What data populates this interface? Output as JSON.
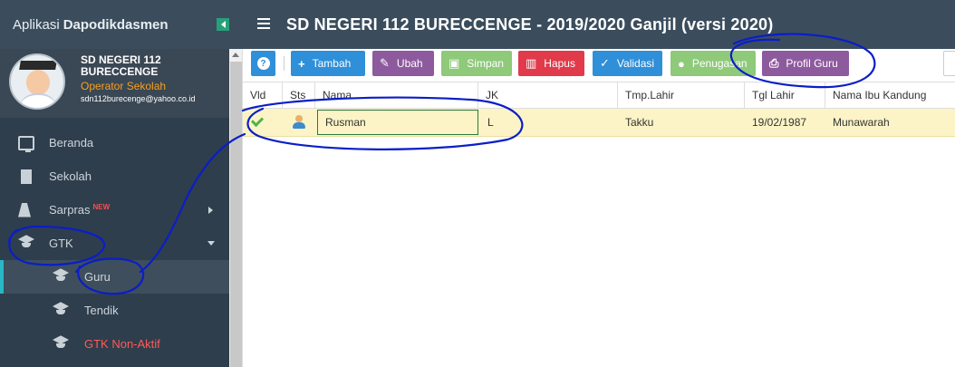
{
  "sidebar": {
    "app_prefix": "Aplikasi",
    "app_name": "Dapodikdasmen",
    "school_name": "SD NEGERI 112 BURECCENGE",
    "role": "Operator Sekolah",
    "email": "sdn112burecenge@yahoo.co.id",
    "items": [
      {
        "label": "Beranda",
        "icon": "monitor-icon"
      },
      {
        "label": "Sekolah",
        "icon": "building-icon"
      },
      {
        "label": "Sarpras",
        "badge": "NEW",
        "icon": "road-icon"
      },
      {
        "label": "GTK",
        "icon": "graduation-cap-icon"
      },
      {
        "label": "Guru",
        "icon": "graduation-cap-icon",
        "active": true
      },
      {
        "label": "Tendik",
        "icon": "graduation-cap-icon"
      },
      {
        "label": "GTK Non-Aktif",
        "icon": "graduation-cap-icon",
        "color": "#ff5a5a"
      }
    ]
  },
  "header": {
    "title": "SD NEGERI 112 BURECCENGE - 2019/2020 Ganjil (versi 2020)"
  },
  "toolbar": {
    "help": "?",
    "add": "Tambah",
    "edit": "Ubah",
    "save": "Simpan",
    "delete": "Hapus",
    "validate": "Validasi",
    "assign": "Penugasan",
    "profile": "Profil Guru"
  },
  "table": {
    "columns": [
      "Vld",
      "Sts",
      "Nama",
      "JK",
      "Tmp.Lahir",
      "Tgl Lahir",
      "Nama Ibu Kandung"
    ],
    "rows": [
      {
        "vld": "check-icon",
        "sts": "person-icon",
        "nama": "Rusman",
        "jk": "L",
        "tmp_lahir": "Takku",
        "tgl_lahir": "19/02/1987",
        "ibu": "Munawarah"
      }
    ]
  },
  "colors": {
    "sidebar_bg": "#2f3e4c",
    "header_bg": "#3b4d5d",
    "selected_row": "#fcf4c6",
    "annotation_ink": "#0a1ec8"
  }
}
